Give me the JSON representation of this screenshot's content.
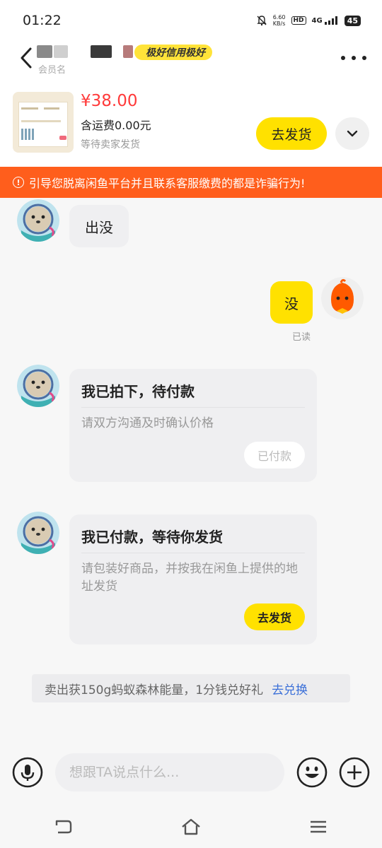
{
  "status_bar": {
    "time": "01:22",
    "speed_value": "6.60",
    "speed_unit": "KB/s",
    "hd": "HD",
    "network": "4G",
    "battery": "45"
  },
  "header": {
    "credit_badge": "极好信用极好",
    "member_label": "会员名"
  },
  "product": {
    "price": "¥38.00",
    "shipping": "含运费0.00元",
    "status": "等待卖家发货",
    "ship_button": "去发货"
  },
  "warning": {
    "text": "引导您脱离闲鱼平台并且联系客服缴费的都是诈骗行为!"
  },
  "messages": [
    {
      "side": "in",
      "text": "出没"
    },
    {
      "side": "out",
      "text": "没",
      "read": "已读"
    }
  ],
  "cards": [
    {
      "title": "我已拍下，待付款",
      "desc": "请双方沟通及时确认价格",
      "button": "已付款"
    },
    {
      "title": "我已付款，等待你发货",
      "desc": "请包装好商品，并按我在闲鱼上提供的地址发货",
      "button": "去发货"
    }
  ],
  "promo": {
    "text": "卖出获150g蚂蚁森林能量，1分钱兑好礼",
    "link": "去兑换"
  },
  "input": {
    "placeholder": "想跟TA说点什么..."
  },
  "colors": {
    "accent_yellow": "#ffe100",
    "warning_orange": "#ff5e1c",
    "price_red": "#ff3a3a",
    "link_blue": "#3a6fd8"
  }
}
